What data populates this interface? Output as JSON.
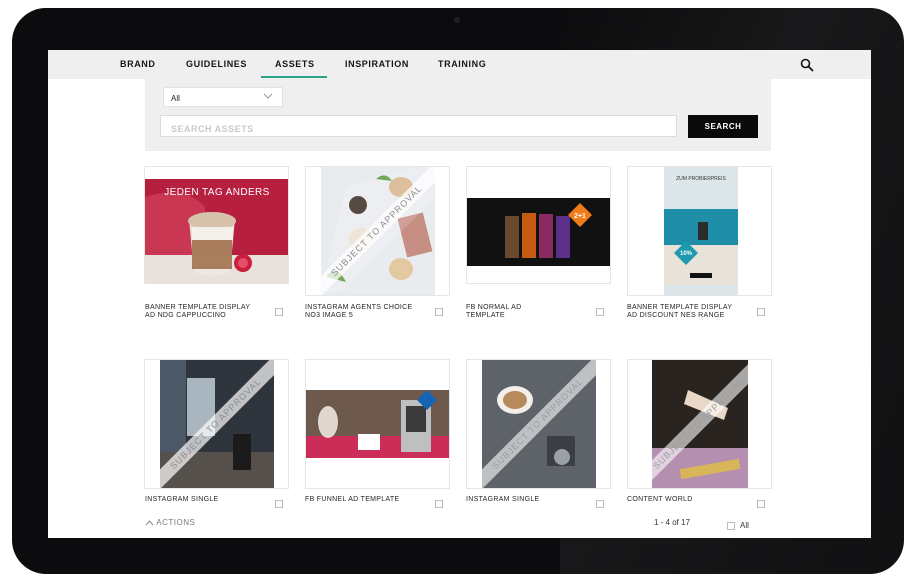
{
  "nav": {
    "items": [
      {
        "label": "BRAND",
        "active": false
      },
      {
        "label": "GUIDELINES",
        "active": false
      },
      {
        "label": "ASSETS",
        "active": true
      },
      {
        "label": "INSPIRATION",
        "active": false
      },
      {
        "label": "TRAINING",
        "active": false
      }
    ],
    "accent_color": "#2aa389"
  },
  "filter": {
    "selected": "All",
    "search_placeholder": "SEARCH ASSETS",
    "search_value": "",
    "search_button": "SEARCH"
  },
  "assets": [
    {
      "label": "BANNER TEMPLATE DISPLAY AD NDG CAPPUCCINO",
      "image_text": "JEDEN TAG ANDERS",
      "subject_to_approval": false
    },
    {
      "label": "INSTAGRAM AGENTS CHOICE NO3 IMAGE 5",
      "image_text": "SUBJECT TO APPROVAL",
      "subject_to_approval": true
    },
    {
      "label": "FB NORMAL AD TEMPLATE",
      "image_text": "2+1",
      "subject_to_approval": false
    },
    {
      "label": "BANNER TEMPLATE DISPLAY AD DISCOUNT NES RANGE",
      "image_text": "ZUM PROBIERPREIS",
      "image_badge": "10%",
      "subject_to_approval": false
    },
    {
      "label": "INSTAGRAM SINGLE",
      "image_text": "SUBJECT TO APPROVAL",
      "subject_to_approval": true
    },
    {
      "label": "FB FUNNEL AD TEMPLATE",
      "image_text": "",
      "subject_to_approval": false
    },
    {
      "label": "INSTAGRAM SINGLE",
      "image_text": "SUBJECT TO APPROVAL",
      "subject_to_approval": true
    },
    {
      "label": "CONTENT WORLD",
      "image_text": "SUBJECT TO APPROVAL",
      "subject_to_approval": true
    }
  ],
  "footer": {
    "actions_label": "ACTIONS",
    "pager_text": "1 - 4 of 17",
    "all_label": "All"
  }
}
